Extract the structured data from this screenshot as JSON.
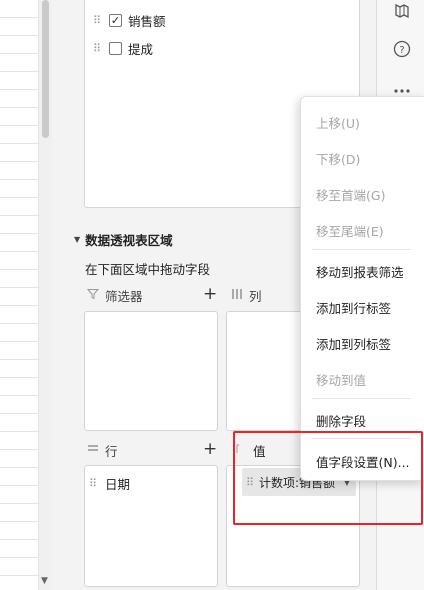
{
  "fields": [
    {
      "label": "销售额",
      "checked": true,
      "check_mark": "✓"
    },
    {
      "label": "提成",
      "checked": false,
      "check_mark": ""
    }
  ],
  "pivot_area": {
    "title": "数据透视表区域",
    "hint": "在下面区域中拖动字段",
    "filter_label": "筛选器",
    "column_label": "列",
    "row_label": "行",
    "value_label": "值",
    "plus_symbol": "+",
    "row_item": "日期",
    "value_item": "计数项:销售额"
  },
  "context_menu": {
    "items": [
      {
        "label": "上移(U)",
        "enabled": false
      },
      {
        "label": "下移(D)",
        "enabled": false
      },
      {
        "label": "移至首端(G)",
        "enabled": false
      },
      {
        "label": "移至尾端(E)",
        "enabled": false
      },
      {
        "label": "移动到报表筛选",
        "enabled": true
      },
      {
        "label": "添加到行标签",
        "enabled": true
      },
      {
        "label": "添加到列标签",
        "enabled": true
      },
      {
        "label": "移动到值",
        "enabled": false
      },
      {
        "label": "删除字段",
        "enabled": true
      },
      {
        "label": "值字段设置(N)...",
        "enabled": true
      }
    ]
  },
  "toolbar": {
    "icons": [
      "map-icon",
      "help-icon",
      "more-icon"
    ]
  },
  "colors": {
    "highlight": "#e3262b",
    "disabled_text": "#a6a6a6"
  }
}
